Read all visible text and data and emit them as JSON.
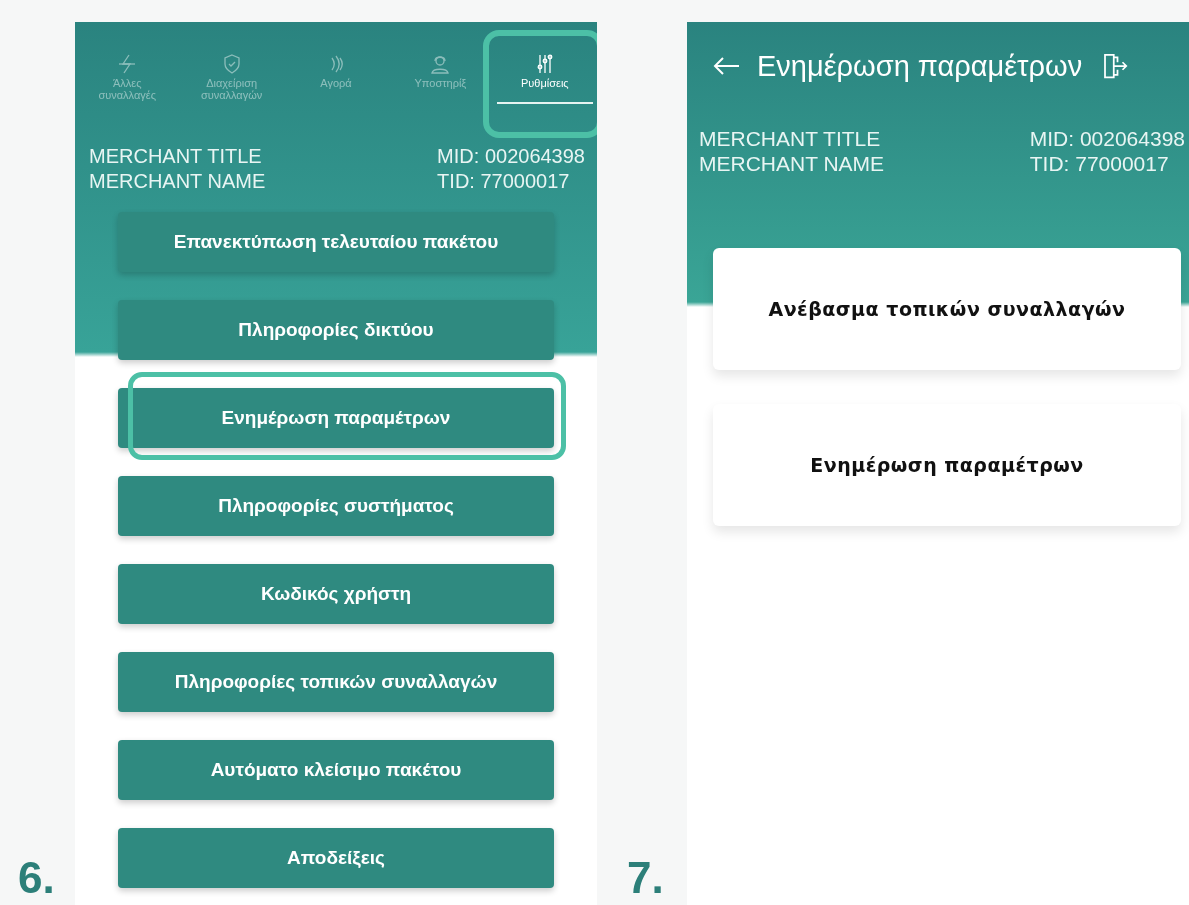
{
  "screens": [
    {
      "step": "6.",
      "kind": "menu",
      "tabs": [
        {
          "label": "Άλλες συναλλαγές",
          "kind": "bolt",
          "selected": false,
          "highlighted": false
        },
        {
          "label": "Διαχείριση συναλλαγών",
          "kind": "shield",
          "selected": false,
          "highlighted": false
        },
        {
          "label": "Αγορά",
          "kind": "contactless",
          "selected": false,
          "highlighted": false
        },
        {
          "label": "Υποστηρίξ",
          "kind": "agent",
          "selected": false,
          "highlighted": false
        },
        {
          "label": "Ρυθμίσεις",
          "kind": "sliders",
          "selected": true,
          "highlighted": true
        }
      ],
      "merchant": {
        "title": "MERCHANT TITLE",
        "name": "MERCHANT NAME",
        "mid": "MID: 002064398",
        "tid": "TID: 77000017"
      },
      "buttons": [
        {
          "label": "Επανεκτύπωση τελευταίου πακέτου",
          "highlighted": false
        },
        {
          "label": "Πληροφορίες δικτύου",
          "highlighted": false
        },
        {
          "label": "Ενημέρωση παραμέτρων",
          "highlighted": true
        },
        {
          "label": "Πληροφορίες συστήματος",
          "highlighted": false
        },
        {
          "label": "Κωδικός χρήστη",
          "highlighted": false
        },
        {
          "label": "Πληροφορίες τοπικών συναλλαγών",
          "highlighted": false
        },
        {
          "label": "Αυτόματο κλείσιμο πακέτου",
          "highlighted": false
        },
        {
          "label": "Αποδείξεις",
          "highlighted": false
        }
      ]
    },
    {
      "step": "7.",
      "kind": "detail",
      "title": "Ενημέρωση παραμέτρων",
      "merchant": {
        "title": "MERCHANT TITLE",
        "name": "MERCHANT NAME",
        "mid": "MID: 002064398",
        "tid": "TID: 77000017"
      },
      "buttons": [
        {
          "label": "Ανέβασμα τοπικών συναλλαγών",
          "highlighted": false
        },
        {
          "label": "Ενημέρωση παραμέτρων",
          "highlighted": false
        }
      ]
    }
  ]
}
